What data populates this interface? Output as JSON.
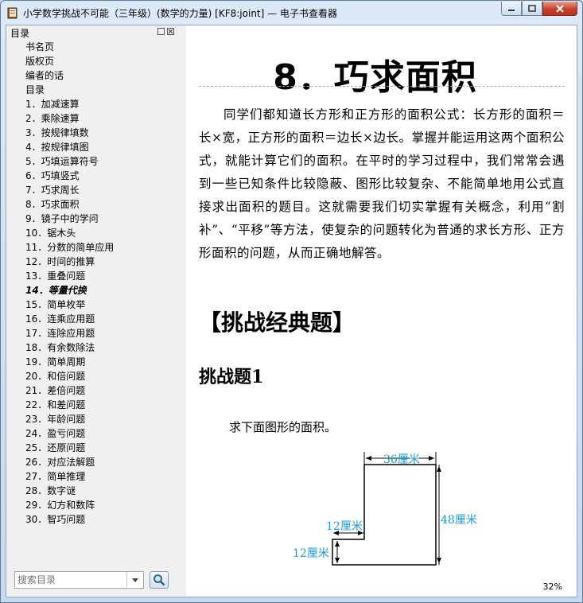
{
  "window": {
    "title": "小学数学挑战不可能（三年级）(数学的力量) [KF8:joint] — 电子书查看器"
  },
  "sidebar": {
    "title": "目录",
    "items": [
      {
        "label": "书名页"
      },
      {
        "label": "版权页"
      },
      {
        "label": "编者的话"
      },
      {
        "label": "目录"
      },
      {
        "label": "1．加减速算"
      },
      {
        "label": "2．乘除速算"
      },
      {
        "label": "3．按规律填数"
      },
      {
        "label": "4．按规律填图"
      },
      {
        "label": "5．巧填运算符号"
      },
      {
        "label": "6．巧填竖式"
      },
      {
        "label": "7．巧求周长"
      },
      {
        "label": "8．巧求面积"
      },
      {
        "label": "9．镜子中的学问"
      },
      {
        "label": "10．锯木头"
      },
      {
        "label": "11．分数的简单应用"
      },
      {
        "label": "12．时间的推算"
      },
      {
        "label": "13．重叠问题"
      },
      {
        "label": "14．等量代换"
      },
      {
        "label": "15．简单枚举"
      },
      {
        "label": "16．连乘应用题"
      },
      {
        "label": "17．连除应用题"
      },
      {
        "label": "18．有余数除法"
      },
      {
        "label": "19．简单周期"
      },
      {
        "label": "20．和倍问题"
      },
      {
        "label": "21．差倍问题"
      },
      {
        "label": "22．和差问题"
      },
      {
        "label": "23．年龄问题"
      },
      {
        "label": "24．盈亏问题"
      },
      {
        "label": "25．还原问题"
      },
      {
        "label": "26．对应法解题"
      },
      {
        "label": "27．简单推理"
      },
      {
        "label": "28．数字谜"
      },
      {
        "label": "29．幻方和数阵"
      },
      {
        "label": "30．智巧问题"
      }
    ],
    "active_index": 17,
    "search": {
      "placeholder": "搜索目录"
    }
  },
  "content": {
    "chapter_title": "8．巧求面积",
    "paragraph": "同学们都知道长方形和正方形的面积公式：长方形的面积＝长×宽，正方形的面积＝边长×边长。掌握并能运用这两个面积公式，就能计算它们的面积。在平时的学习过程中，我们常常会遇到一些已知条件比较隐蔽、图形比较复杂、不能简单地用公式直接求出面积的题目。这就需要我们切实掌握有关概念，利用“割补”、“平移”等方法，使复杂的问题转化为普通的求长方形、正方形面积的问题，从而正确地解答。",
    "section_heading": "【挑战经典题】",
    "problem_heading": "挑战题1",
    "problem_text": "求下面图形的面积。",
    "figure": {
      "label_top": "36厘米",
      "label_right": "48厘米",
      "label_step": "12厘米",
      "label_left": "12厘米",
      "label_color": "#1a9ad6"
    }
  },
  "status": {
    "zoom": "32%"
  }
}
